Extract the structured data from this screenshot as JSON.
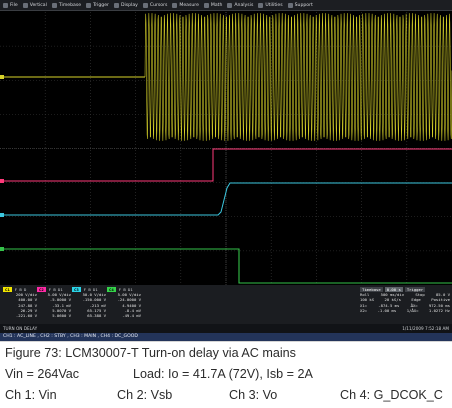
{
  "menubar": {
    "items": [
      {
        "icon": "file-icon",
        "label": "File"
      },
      {
        "icon": "vertical-icon",
        "label": "Vertical"
      },
      {
        "icon": "timebase-icon",
        "label": "Timebase"
      },
      {
        "icon": "trigger-icon",
        "label": "Trigger"
      },
      {
        "icon": "display-icon",
        "label": "Display"
      },
      {
        "icon": "cursors-icon",
        "label": "Cursors"
      },
      {
        "icon": "measure-icon",
        "label": "Measure"
      },
      {
        "icon": "math-icon",
        "label": "Math"
      },
      {
        "icon": "analysis-icon",
        "label": "Analysis"
      },
      {
        "icon": "utilities-icon",
        "label": "Utilities"
      },
      {
        "icon": "support-icon",
        "label": "Support"
      }
    ]
  },
  "channels": [
    {
      "tag": "C1",
      "hdr": "F B D",
      "color": "#f2e600",
      "rows": [
        "200 V/div",
        "400.00 V",
        "247.88 V",
        "26.29 V",
        "-221.60 V"
      ]
    },
    {
      "tag": "C2",
      "hdr": "F B D1",
      "color": "#ff2aa6",
      "rows": [
        "5.00 V/div",
        "-5.0000 V",
        "-33.1 mV",
        "5.0070 V",
        "5.0600 V"
      ]
    },
    {
      "tag": "C3",
      "hdr": "F B D1",
      "color": "#2bd4e8",
      "rows": [
        "50.0 V/div",
        "-150.000 V",
        "-213 mV",
        "65.175 V",
        "65.388 V"
      ]
    },
    {
      "tag": "C4",
      "hdr": "F B D1",
      "color": "#35d44a",
      "rows": [
        "5.00 V/div",
        "-24.0000 V",
        "4.9400 V",
        "-8.4 mV",
        "-49.4 mV"
      ]
    }
  ],
  "timebase": {
    "labels": [
      "Timebase",
      "0.00 s",
      "Trigger"
    ],
    "rows": [
      [
        "Roll",
        "500 ms/div",
        "Stop",
        "85.0 V"
      ],
      [
        "100 kS",
        "20 kS/s",
        "Edge",
        "Positive"
      ],
      [
        "X1=",
        "-874.5 ms",
        "ΔX=",
        "972.50 ms"
      ],
      [
        "X2=",
        "-1.00 ms",
        "1/ΔX=",
        "1.0272 Hz"
      ]
    ]
  },
  "status": {
    "left": "TURN ON DELAY",
    "right": "1/11/2009 7:52:18 AM"
  },
  "channel_labels": "CH1 : AC_LINE , CH2 : STBY , CH3 : MAIN , CH4 : DC_GOOD",
  "caption": {
    "figure": "Figure 73:    LCM30007-T Turn-on delay via AC mains",
    "vin": "Vin = 264Vac",
    "load": "Load: Io = 41.7A (72V), Isb = 2A",
    "ch1": "Ch 1: Vin",
    "ch2": "Ch 2: Vsb",
    "ch3": "Ch 3: Vo",
    "ch4": "Ch 4: G_DCOK_C"
  }
}
